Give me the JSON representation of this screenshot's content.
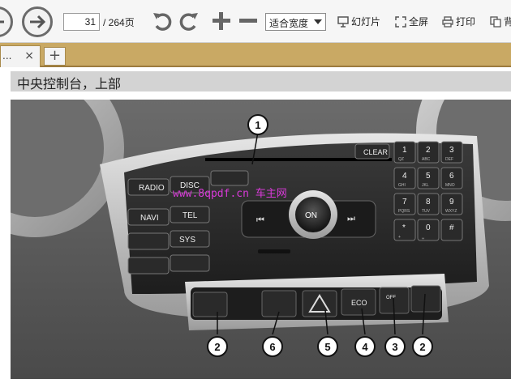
{
  "toolbar": {
    "current_page": "31",
    "page_total": "/ 264页",
    "zoom_selected": "适合宽度",
    "slideshow_label": "幻灯片",
    "fullscreen_label": "全屏",
    "print_label": "打印",
    "extra_label": "背"
  },
  "tabs": {
    "active_tab_label": "...",
    "close_symbol": "×",
    "new_tab_symbol": "+"
  },
  "document": {
    "heading": "中央控制台，上部",
    "figure": {
      "callouts": [
        "1",
        "2",
        "6",
        "5",
        "4",
        "3",
        "2"
      ],
      "buttons": {
        "radio": "RADIO",
        "disc": "DISC",
        "navi": "NAVI",
        "tel": "TEL",
        "sys": "SYS",
        "clear": "CLEAR",
        "on": "ON",
        "eco": "ECO",
        "off": "OFF"
      },
      "keypad": [
        {
          "num": "1",
          "sub": "QZ"
        },
        {
          "num": "2",
          "sub": "ABC"
        },
        {
          "num": "3",
          "sub": "DEF"
        },
        {
          "num": "4",
          "sub": "GHI"
        },
        {
          "num": "5",
          "sub": "JKL"
        },
        {
          "num": "6",
          "sub": "MNO"
        },
        {
          "num": "7",
          "sub": "PQRS"
        },
        {
          "num": "8",
          "sub": "TUV"
        },
        {
          "num": "9",
          "sub": "WXYZ"
        },
        {
          "num": "*",
          "sub": "+"
        },
        {
          "num": "0",
          "sub": "␣"
        },
        {
          "num": "#",
          "sub": ""
        }
      ],
      "watermark": "www.8qpdf.cn 车主网"
    }
  },
  "colors": {
    "tab_bar": "#c9a964",
    "heading_bg": "#d3d3d3",
    "watermark": "#d93ad9"
  }
}
